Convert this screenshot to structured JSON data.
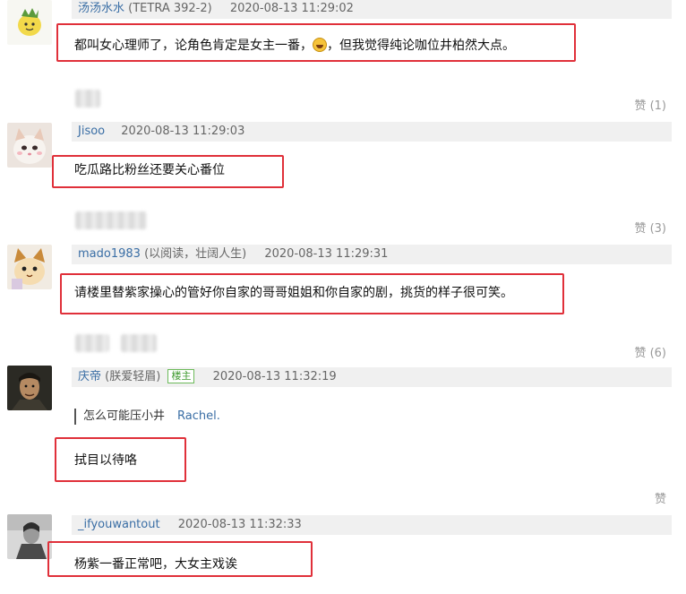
{
  "comments": [
    {
      "user": "汤汤水水",
      "nick": "(TETRA 392-2)",
      "time": "2020-08-13 11:29:02",
      "text_before": "都叫女心理师了，论角色肯定是女主一番，",
      "text_after": "，但我觉得纯论咖位井柏然大点。"
    },
    {
      "user": "Jisoo",
      "nick": "",
      "time": "2020-08-13 11:29:03",
      "text": "吃瓜路比粉丝还要关心番位",
      "like_before": "赞 (1)"
    },
    {
      "user": "mado1983",
      "nick": "(以阅读，壮阔人生)",
      "time": "2020-08-13 11:29:31",
      "text": "请楼里替紫家操心的管好你自家的哥哥姐姐和你自家的剧，挑货的样子很可笑。",
      "like_before": "赞 (3)"
    },
    {
      "user": "庆帝",
      "nick": "(朕爱轻眉)",
      "badge": "楼主",
      "time": "2020-08-13 11:32:19",
      "quote": "怎么可能压小井",
      "quote_ref": "Rachel.",
      "text": "拭目以待咯",
      "like_before": "赞 (6)"
    },
    {
      "user": "_ifyouwantout",
      "nick": "",
      "time": "2020-08-13 11:32:33",
      "text": "杨紫一番正常吧，大女主戏诶",
      "like_before": "赞"
    }
  ],
  "icons": {
    "emoji": "grinning-emoji-icon"
  },
  "colors": {
    "highlight_border": "#e0303a",
    "username": "#3a6ea5",
    "badge": "#3f9a2f"
  }
}
